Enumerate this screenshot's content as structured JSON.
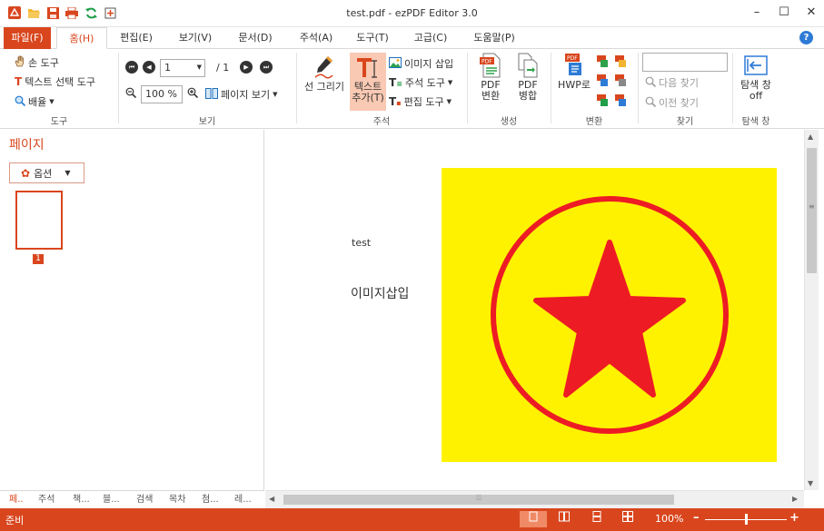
{
  "window": {
    "title": "test.pdf - ezPDF Editor 3.0",
    "minimize": "–",
    "maximize": "☐",
    "close": "✕"
  },
  "tabs": [
    {
      "label": "파일(F)"
    },
    {
      "label": "홈(H)"
    },
    {
      "label": "편집(E)"
    },
    {
      "label": "보기(V)"
    },
    {
      "label": "문서(D)"
    },
    {
      "label": "주석(A)"
    },
    {
      "label": "도구(T)"
    },
    {
      "label": "고급(C)"
    },
    {
      "label": "도움말(P)"
    }
  ],
  "active_tab": "홈(H)",
  "help": "?",
  "ribbon": {
    "tools_group": {
      "hand_tool": "손 도구",
      "text_select_tool": "텍스트 선택 도구",
      "zoom_tool": "배율",
      "label": "도구"
    },
    "view_group": {
      "page_value": "1",
      "page_total": "/ 1",
      "zoom_value": "100 %",
      "page_view": "페이지 보기",
      "label": "보기"
    },
    "annot_group": {
      "draw_line": "선 그리기",
      "add_text_line1": "텍스트",
      "add_text_line2": "추가(T)",
      "insert_image": "이미지 삽입",
      "annot_tool": "주석 도구",
      "edit_tool": "편집 도구",
      "label": "주석"
    },
    "create_group": {
      "pdf_convert_line1": "PDF",
      "pdf_convert_line2": "변환",
      "pdf_merge_line1": "PDF",
      "pdf_merge_line2": "병합",
      "label": "생성"
    },
    "convert_group": {
      "hwp_convert": "HWP로",
      "label": "변환"
    },
    "find_group": {
      "search_value": "",
      "find_next": "다음 찾기",
      "find_prev": "이전 찾기",
      "label": "찾기"
    },
    "nav_group": {
      "nav_off_line1": "탐색 창",
      "nav_off_line2": "off",
      "label": "탐색 창"
    }
  },
  "left_panel": {
    "title": "페이지",
    "options_label": "옵션",
    "thumbnail_page": "1",
    "bottom_tabs": [
      "페..",
      "주석",
      "책...",
      "블...",
      "검색",
      "목차",
      "첨...",
      "레..."
    ]
  },
  "document": {
    "text_small": "test",
    "text_large": "이미지삽입",
    "image_colors": {
      "background": "#fff200",
      "shape": "#ed1c24"
    }
  },
  "statusbar": {
    "status": "준비",
    "zoom": "100%",
    "zoom_level_fraction": 0.5,
    "minus": "–",
    "plus": "+"
  },
  "colors": {
    "accent": "#d9461e"
  }
}
